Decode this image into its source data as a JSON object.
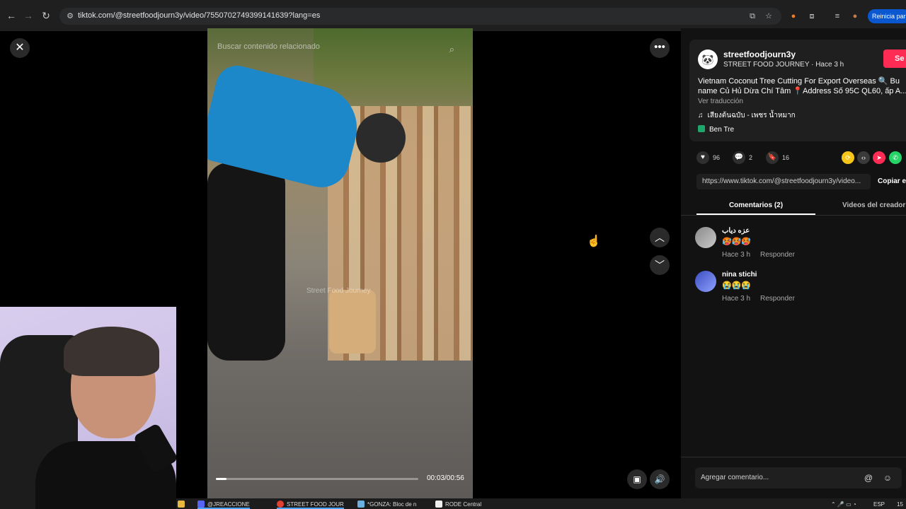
{
  "browser": {
    "url": "tiktok.com/@streetfoodjourn3y/video/7550702749399141639?lang=es",
    "restart_label": "Reinicia para"
  },
  "video": {
    "search_placeholder": "Buscar contenido relacionado",
    "watermark": "Street Food Journey",
    "time": "00:03/00:56",
    "progress_fraction": 0.054
  },
  "post": {
    "creator_handle": "streetfoodjourn3y",
    "creator_sub": "STREET FOOD JOURNEY · Hace 3 h",
    "follow_label": "Se",
    "caption": "Vietnam Coconut Tree Cutting For Export Overseas 🔍 Bu name Củ Hủ Dừa Chí Tâm 📍Address Số 95C QL60, ấp A...",
    "translate_label": "Ver traducción",
    "music": "เสียงต้นฉบับ - เพชร น้ำหมาก",
    "location": "Ben Tre"
  },
  "stats": {
    "likes": "96",
    "comments": "2",
    "saves": "16"
  },
  "share": {
    "link": "https://www.tiktok.com/@streetfoodjourn3y/video...",
    "copy_label": "Copiar e"
  },
  "tabs": {
    "comments": "Comentarios (2)",
    "creator_videos": "Videos del creador"
  },
  "comments": [
    {
      "user": "عزه دياب",
      "text": "🥵🥵🥵",
      "time": "Hace 3 h",
      "reply": "Responder"
    },
    {
      "user": "nina stichi",
      "text": "😭😭😭",
      "time": "Hace 3 h",
      "reply": "Responder"
    }
  ],
  "comment_input": {
    "placeholder": "Agregar comentario..."
  },
  "taskbar": {
    "items": [
      "@JREACCIONE",
      "STREET FOOD JOUR",
      "*GONZA: Bloc de n",
      "RODE Central"
    ],
    "lang": "ESP",
    "clock": "15"
  },
  "colors": {
    "accent": "#fe2c55",
    "panel_bg": "#121212",
    "card_bg": "#1f1f1f"
  }
}
